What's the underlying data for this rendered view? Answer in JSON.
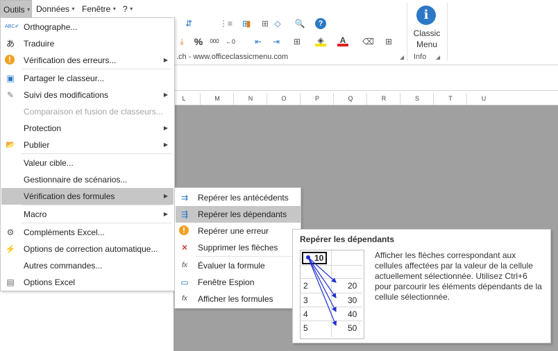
{
  "menubar": {
    "items": [
      {
        "label": "Outils"
      },
      {
        "label": "Données"
      },
      {
        "label": "Fenêtre"
      },
      {
        "label": "?"
      }
    ]
  },
  "ribbon": {
    "website": ".ch  -  www.officeclassicmenu.com",
    "classic_menu": "Classic Menu",
    "classic_line1": "Classic",
    "classic_line2": "Menu",
    "info_glyph": "i",
    "info_group": "Info",
    "percent": "%",
    "thousands": "000"
  },
  "columns": [
    "L",
    "M",
    "N",
    "O",
    "P",
    "Q",
    "R",
    "S",
    "T",
    "U"
  ],
  "main_menu": {
    "items": [
      {
        "label": "Orthographe...",
        "icon": "spelling-icon",
        "glyph": "ABC✔"
      },
      {
        "label": "Traduire",
        "icon": "translate-icon",
        "glyph": "あ"
      },
      {
        "label": "Vérification des erreurs...",
        "icon": "error-check-icon",
        "glyph": "!",
        "submenu": true
      },
      {
        "label": "Partager le classeur...",
        "icon": "share-workbook-icon",
        "glyph": "▣"
      },
      {
        "label": "Suivi des modifications",
        "icon": "track-changes-icon",
        "glyph": "✎",
        "submenu": true
      },
      {
        "label": "Comparaison et fusion de classeurs...",
        "disabled": true
      },
      {
        "label": "Protection",
        "submenu": true
      },
      {
        "label": "Publier",
        "icon": "publish-icon",
        "glyph": "📂",
        "submenu": true
      },
      {
        "label": "Valeur cible..."
      },
      {
        "label": "Gestionnaire de scénarios..."
      },
      {
        "label": "Vérification des formules",
        "submenu": true
      },
      {
        "label": "Macro",
        "submenu": true
      },
      {
        "label": "Compléments Excel...",
        "icon": "addins-icon",
        "glyph": "⚙"
      },
      {
        "label": "Options de correction automatique...",
        "icon": "autocorrect-icon",
        "glyph": "⚡"
      },
      {
        "label": "Autres commandes..."
      },
      {
        "label": "Options Excel",
        "icon": "excel-options-icon",
        "glyph": "▤"
      }
    ]
  },
  "submenu": {
    "items": [
      {
        "label": "Repérer les antécédents",
        "icon": "trace-precedents-icon",
        "glyph": "⇉"
      },
      {
        "label": "Repérer les dépendants",
        "icon": "trace-dependents-icon",
        "glyph": "⇶"
      },
      {
        "label": "Repérer une erreur",
        "icon": "trace-error-icon",
        "glyph": "!"
      },
      {
        "label": "Supprimer les flèches",
        "icon": "remove-arrows-icon",
        "glyph": "✕"
      },
      {
        "label": "Évaluer la formule",
        "icon": "evaluate-formula-icon",
        "glyph": "fx"
      },
      {
        "label": "Fenêtre Espion",
        "icon": "watch-window-icon",
        "glyph": "▭"
      },
      {
        "label": "Afficher les formules",
        "icon": "show-formulas-icon",
        "glyph": "fx"
      }
    ]
  },
  "tooltip": {
    "title": "Repérer les dépendants",
    "description": "Afficher les flèches correspondant aux cellules affectées par la valeur de la cellule actuellement sélectionnée. Utilisez Ctrl+6 pour parcourir les éléments dépendants de la cellule sélectionnée.",
    "picture": {
      "source": "10",
      "rows": [
        {
          "left": "2",
          "right": "20"
        },
        {
          "left": "3",
          "right": "30"
        },
        {
          "left": "4",
          "right": "40"
        },
        {
          "left": "5",
          "right": "50"
        }
      ]
    }
  },
  "colors": {
    "highlight": "#c6c6c6",
    "grid_background": "#a0a0a0",
    "arrow": "#1f2fd0",
    "info_blue": "#2b78c5"
  }
}
